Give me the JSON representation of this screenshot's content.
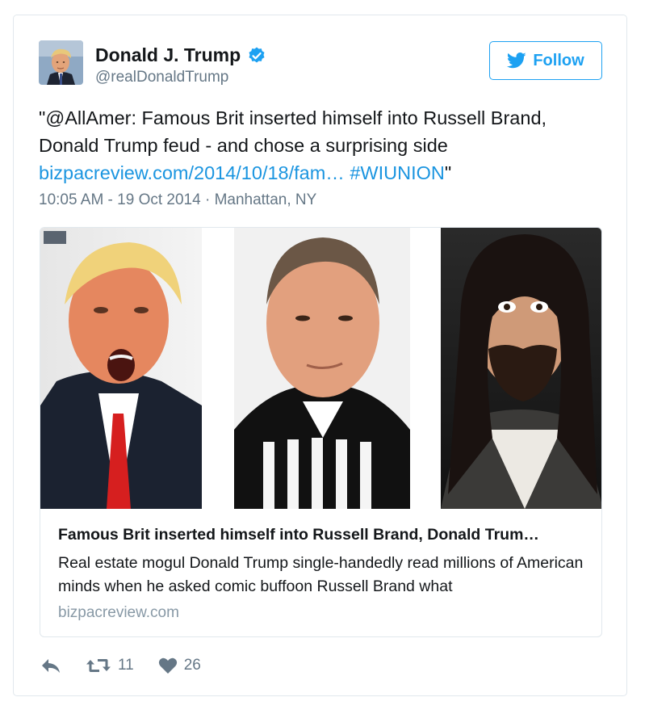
{
  "user": {
    "name": "Donald J. Trump",
    "handle": "@realDonaldTrump",
    "verified_icon": "verified-badge-icon"
  },
  "follow_button": {
    "label": "Follow",
    "icon": "twitter-bird-icon"
  },
  "tweet": {
    "text_plain": "\"@AllAmer: Famous Brit inserted himself into Russell Brand, Donald Trump feud - and chose a surprising side ",
    "link": "bizpacreview.com/2014/10/18/fam…",
    "hashtag": "#WIUNION",
    "text_end": "\"",
    "timestamp": "10:05 AM - 19 Oct 2014 · Manhattan, NY"
  },
  "card": {
    "title": "Famous Brit inserted himself into Russell Brand, Donald Trum…",
    "description": "Real estate mogul Donald Trump single-handedly read millions of American minds when he asked comic buffoon Russell Brand what",
    "domain": "bizpacreview.com"
  },
  "actions": {
    "reply_icon": "reply-icon",
    "retweet_icon": "retweet-icon",
    "retweet_count": "11",
    "like_icon": "heart-icon",
    "like_count": "26"
  },
  "colors": {
    "accent": "#1da1f2",
    "link": "#1b95e0",
    "secondary_text": "#657786",
    "border": "#e1e8ed"
  }
}
